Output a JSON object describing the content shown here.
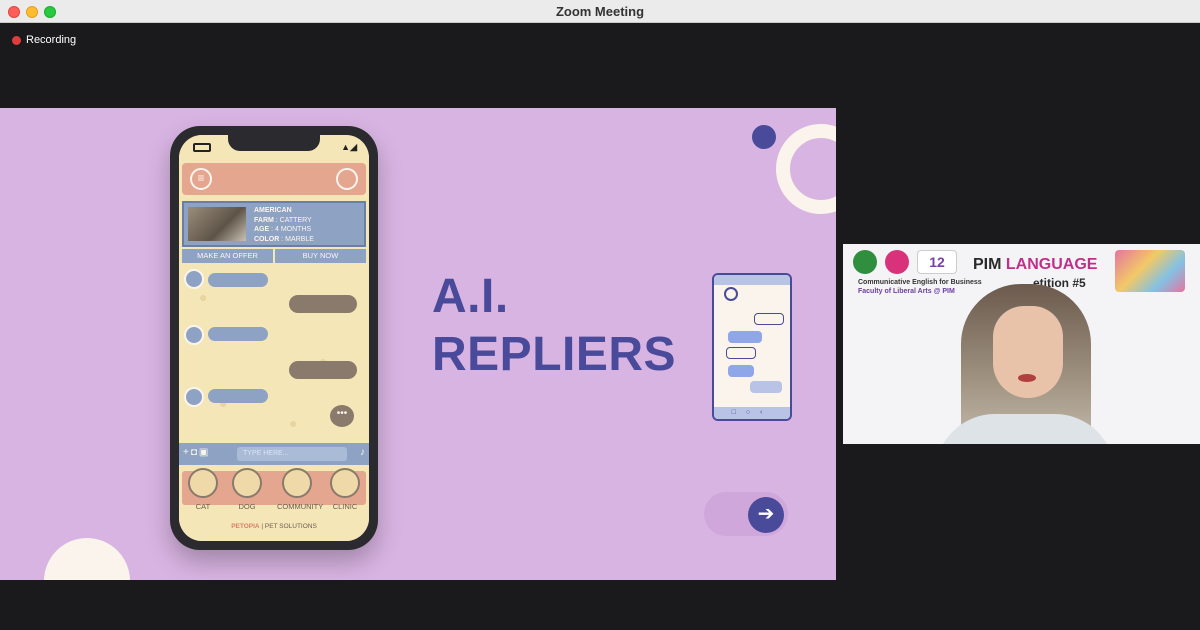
{
  "window": {
    "title": "Zoom Meeting"
  },
  "recording": {
    "label": "Recording"
  },
  "slide": {
    "headline_line1": "A.I.",
    "headline_line2": "REPLIERS",
    "phone": {
      "pet": {
        "breed": "AMERICAN",
        "farm_label": "FARM",
        "farm_value": ": CATTERY",
        "age_label": "AGE",
        "age_value": ": 4 MONTHS",
        "color_label": "COLOR",
        "color_value": ": MARBLE"
      },
      "actions": {
        "offer": "MAKE AN OFFER",
        "buy": "BUY NOW"
      },
      "input_placeholder": "TYPE HERE...",
      "nav": [
        "CAT",
        "DOG",
        "COMMUNITY",
        "CLINIC"
      ],
      "brand_name": "PETOPIA",
      "brand_tag": "| PET SOLUTIONS"
    }
  },
  "video": {
    "badge_12": "12",
    "program": "Communicative English for Business",
    "faculty": "Faculty of Liberal Arts @ PIM",
    "title_pim": "PIM ",
    "title_lang": "LANGUAGE",
    "competition": "...etition #5"
  },
  "colors": {
    "slide_bg": "#d8b4e2",
    "headline": "#4a4a9a",
    "phone_cream": "#f5e6b8",
    "phone_blue": "#8ea3c4",
    "phone_salmon": "#e5a68f",
    "recording_dot": "#e23b3b"
  },
  "icons": [
    "recording-dot-icon",
    "battery-icon",
    "signal-icon",
    "menu-icon",
    "profile-icon",
    "camera-icon",
    "image-icon",
    "mic-icon",
    "cat-icon",
    "dog-icon",
    "community-icon",
    "clinic-icon",
    "next-arrow-icon"
  ]
}
